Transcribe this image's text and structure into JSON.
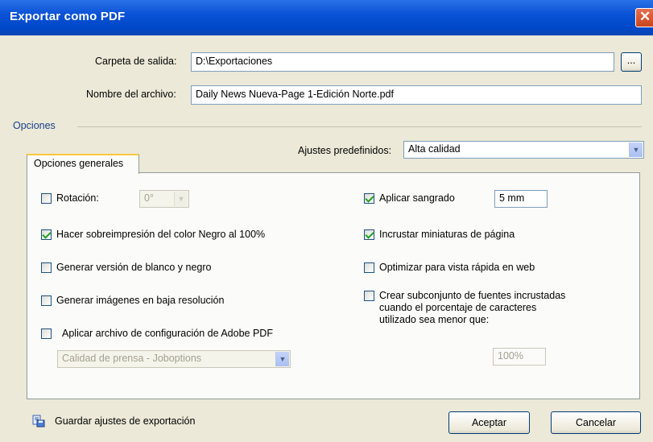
{
  "window": {
    "title": "Exportar como PDF"
  },
  "output": {
    "folder_label": "Carpeta de salida:",
    "folder_value": "D:\\Exportaciones",
    "browse_label": "...",
    "filename_label": "Nombre del archivo:",
    "filename_value": "Daily News Nueva-Page 1-Edición Norte.pdf"
  },
  "options": {
    "section_label": "Opciones",
    "presets_label": "Ajustes predefinidos:",
    "presets_value": "Alta calidad",
    "tab_label": "Opciones generales",
    "rotation": {
      "label": "Rotación:",
      "value": "0°",
      "checked": false
    },
    "overprint": {
      "label": "Hacer sobreimpresión del color Negro al 100%",
      "checked": true
    },
    "grayscale": {
      "label": "Generar versión de blanco y negro",
      "checked": false
    },
    "lowres": {
      "label": "Generar imágenes en baja resolución",
      "checked": false
    },
    "adobe_config": {
      "label": "Aplicar archivo de configuración de Adobe PDF",
      "checked": false,
      "value": "Calidad de prensa - Joboptions"
    },
    "bleed": {
      "label": "Aplicar sangrado",
      "checked": true,
      "value": "5 mm"
    },
    "thumbnails": {
      "label": "Incrustar miniaturas de página",
      "checked": true
    },
    "fastweb": {
      "label": "Optimizar para vista rápida en web",
      "checked": false
    },
    "subset": {
      "label": "Crear subconjunto de fuentes incrustadas cuando el porcentaje de caracteres utilizado sea menor que:",
      "checked": false,
      "value": "100%"
    }
  },
  "footer": {
    "save_settings_label": "Guardar ajustes de exportación",
    "accept_label": "Aceptar",
    "cancel_label": "Cancelar"
  },
  "colors": {
    "titlebar": "#0a52d6",
    "dialog_bg": "#ece9d8",
    "check": "#21a121",
    "tab_highlight": "#ffc83c"
  }
}
